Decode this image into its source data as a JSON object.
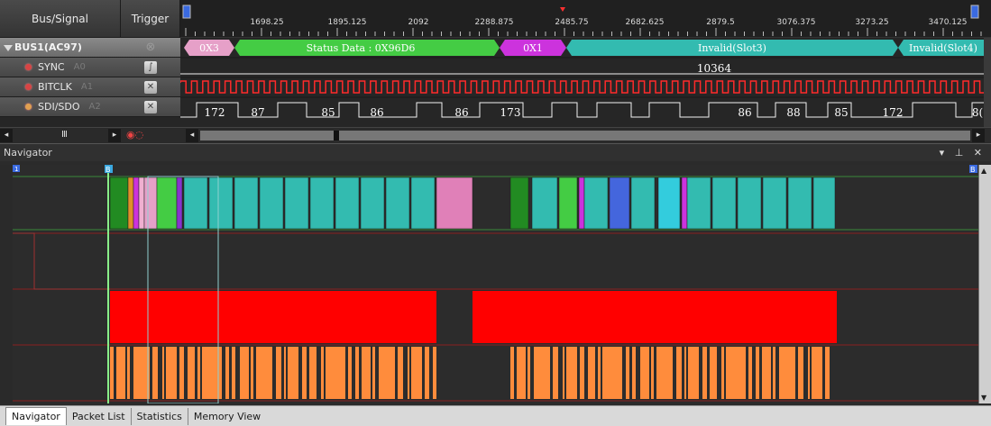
{
  "header": {
    "bus_signal": "Bus/Signal",
    "trigger": "Trigger"
  },
  "rows": [
    {
      "label": "BUS1(AC97)",
      "channel": ""
    },
    {
      "label": "SYNC",
      "channel": "A0"
    },
    {
      "label": "BITCLK",
      "channel": "A1"
    },
    {
      "label": "SDI/SDO",
      "channel": "A2"
    }
  ],
  "ruler": {
    "ticks": [
      "1698.25",
      "1895.125",
      "2092",
      "2288.875",
      "2485.75",
      "2682.625",
      "2879.5",
      "3076.375",
      "3273.25",
      "3470.125"
    ]
  },
  "bus_segments": [
    {
      "text": "0X3",
      "color": "#e6a0c8"
    },
    {
      "text": "Status Data : 0X96D6",
      "color": "#44cc44"
    },
    {
      "text": "0X1",
      "color": "#cc33dd"
    },
    {
      "text": "Invalid(Slot3)",
      "color": "#33bbb0"
    },
    {
      "text": "Invalid(Slot4)",
      "color": "#33bbb0"
    }
  ],
  "sync_value": "10364",
  "sdi_values": [
    "172",
    "87",
    "85",
    "86",
    "86",
    "173",
    "86",
    "88",
    "85",
    "172",
    "8("
  ],
  "navigator": {
    "title": "Navigator",
    "marker_a": "1",
    "marker_b": "B",
    "marker_c": "B"
  },
  "tabs": [
    "Navigator",
    "Packet List",
    "Statistics",
    "Memory View"
  ],
  "colors": {
    "bus_green": "#44cc44",
    "bus_cyan": "#33bbb0",
    "bus_pink": "#e6a0c8",
    "bus_purple": "#cc33dd",
    "nav_red": "#ff0000",
    "nav_orange": "#ff8c3c",
    "cursor_green": "#88ee88"
  }
}
